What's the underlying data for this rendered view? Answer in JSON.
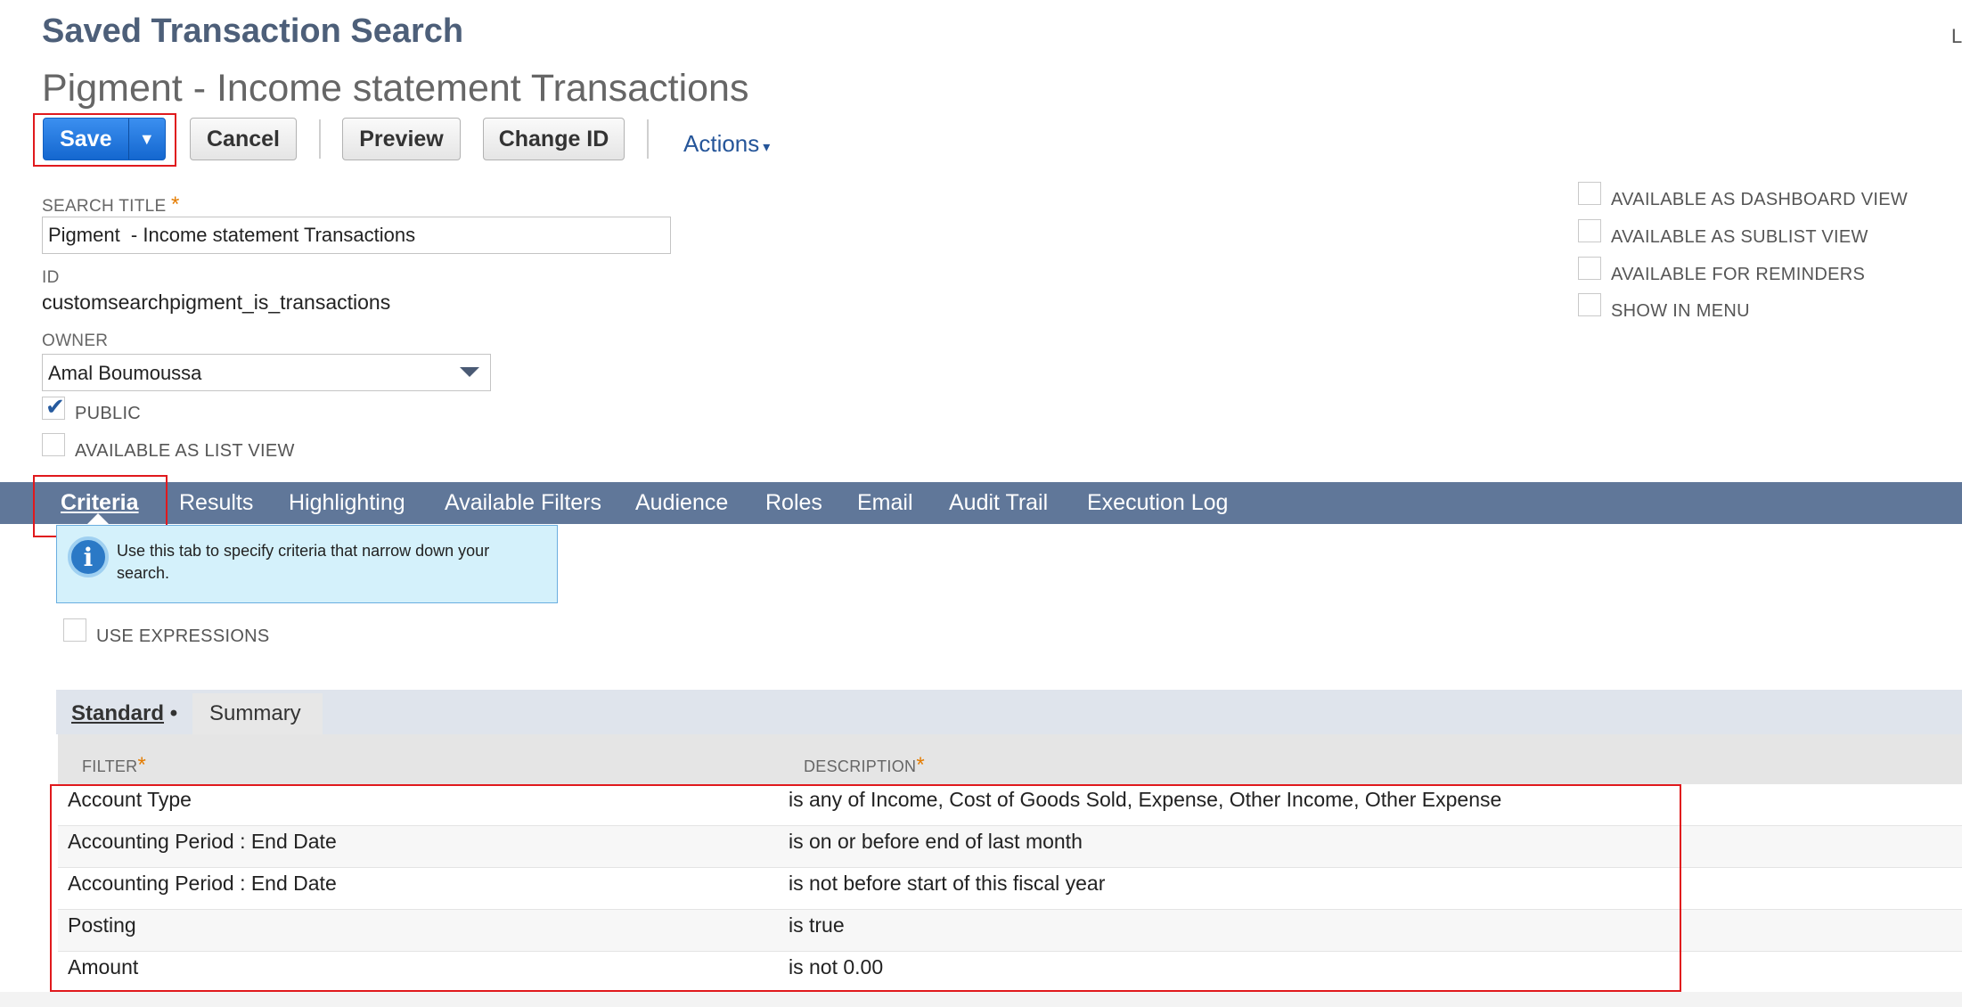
{
  "header": {
    "page_title": "Saved Transaction Search",
    "search_name": "Pigment - Income statement Transactions",
    "corner_text": "L"
  },
  "toolbar": {
    "save_label": "Save",
    "save_menu_glyph": "▼",
    "cancel_label": "Cancel",
    "preview_label": "Preview",
    "change_id_label": "Change ID",
    "actions_label": "Actions",
    "actions_caret": "▾"
  },
  "form": {
    "search_title_label": "SEARCH TITLE",
    "search_title_value": "Pigment  - Income statement Transactions",
    "id_label": "ID",
    "id_value": "customsearchpigment_is_transactions",
    "owner_label": "OWNER",
    "owner_value": "Amal Boumoussa",
    "public_label": "PUBLIC",
    "public_checked": true,
    "list_view_label": "AVAILABLE AS LIST VIEW",
    "list_view_checked": false
  },
  "options": {
    "dashboard_label": "AVAILABLE AS DASHBOARD VIEW",
    "sublist_label": "AVAILABLE AS SUBLIST VIEW",
    "reminders_label": "AVAILABLE FOR REMINDERS",
    "show_menu_label": "SHOW IN MENU"
  },
  "tabs": [
    {
      "label": "Criteria",
      "active": true
    },
    {
      "label": "Results"
    },
    {
      "label": "Highlighting"
    },
    {
      "label": "Available Filters"
    },
    {
      "label": "Audience"
    },
    {
      "label": "Roles"
    },
    {
      "label": "Email"
    },
    {
      "label": "Audit Trail"
    },
    {
      "label": "Execution Log"
    }
  ],
  "info": {
    "icon": "info-icon",
    "text": "Use this tab to specify criteria that narrow down your search."
  },
  "use_expressions_label": "USE EXPRESSIONS",
  "subtabs": {
    "standard_label": "Standard",
    "standard_dot": "•",
    "summary_label": "Summary"
  },
  "criteria_table": {
    "filter_header": "FILTER",
    "description_header": "DESCRIPTION",
    "rows": [
      {
        "filter": "Account Type",
        "description": "is any of Income, Cost of Goods Sold, Expense, Other Income, Other Expense"
      },
      {
        "filter": "Accounting Period : End Date",
        "description": "is on or before end of last month"
      },
      {
        "filter": "Accounting Period : End Date",
        "description": "is not before start of this fiscal year"
      },
      {
        "filter": "Posting",
        "description": "is true"
      },
      {
        "filter": "Amount",
        "description": "is not 0.00"
      }
    ]
  },
  "colors": {
    "tab_bar": "#607799",
    "save_button": "#1f74dd",
    "highlight_box": "#e0191d",
    "required_star": "#e47c00"
  }
}
